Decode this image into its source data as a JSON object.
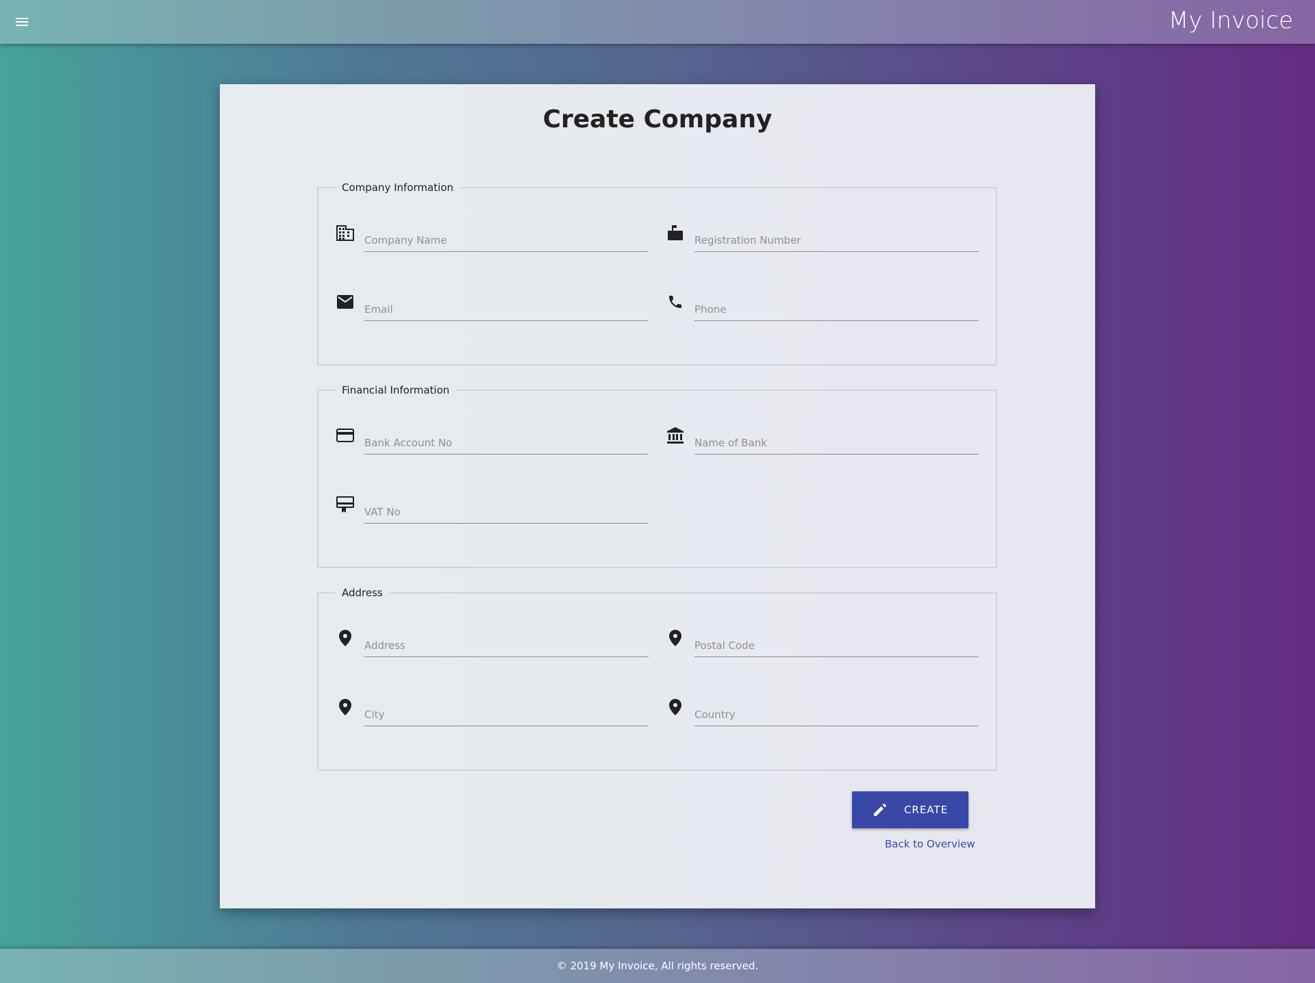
{
  "header": {
    "title": "My Invoice",
    "menu_icon": "menu-icon"
  },
  "page": {
    "title": "Create Company"
  },
  "sections": {
    "company": {
      "legend": "Company Information",
      "fields": {
        "company_name": {
          "placeholder": "Company Name",
          "value": "",
          "icon": "building-icon"
        },
        "registration_number": {
          "placeholder": "Registration Number",
          "value": "",
          "icon": "mailbox-icon"
        },
        "email": {
          "placeholder": "Email",
          "value": "",
          "icon": "envelope-icon"
        },
        "phone": {
          "placeholder": "Phone",
          "value": "",
          "icon": "phone-icon"
        }
      }
    },
    "financial": {
      "legend": "Financial Information",
      "fields": {
        "bank_account": {
          "placeholder": "Bank Account No",
          "value": "",
          "icon": "credit-card-icon"
        },
        "bank_name": {
          "placeholder": "Name of Bank",
          "value": "",
          "icon": "bank-icon"
        },
        "vat": {
          "placeholder": "VAT No",
          "value": "",
          "icon": "certificate-icon"
        }
      }
    },
    "address": {
      "legend": "Address",
      "fields": {
        "address": {
          "placeholder": "Address",
          "value": "",
          "icon": "location-pin-icon"
        },
        "postal_code": {
          "placeholder": "Postal Code",
          "value": "",
          "icon": "location-pin-icon"
        },
        "city": {
          "placeholder": "City",
          "value": "",
          "icon": "location-pin-icon"
        },
        "country": {
          "placeholder": "Country",
          "value": "",
          "icon": "location-pin-icon"
        }
      }
    }
  },
  "actions": {
    "create_label": "CREATE",
    "create_icon": "pencil-icon",
    "back_label": "Back to Overview"
  },
  "footer": {
    "text": "© 2019 My Invoice, All rights reserved."
  },
  "colors": {
    "primary": "#3947a6",
    "link": "#3a48a8"
  }
}
